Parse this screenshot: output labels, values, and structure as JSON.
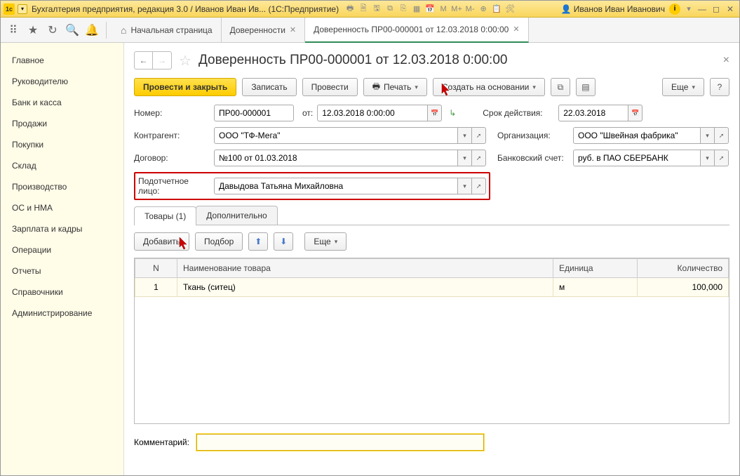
{
  "titlebar": {
    "app_title": "Бухгалтерия предприятия, редакция 3.0 / Иванов Иван Ив...  (1С:Предприятие)",
    "user": "Иванов Иван Иванович"
  },
  "tabs": {
    "home": "Начальная страница",
    "tab1": "Доверенности",
    "tab2": "Доверенность ПР00-000001 от 12.03.2018 0:00:00"
  },
  "sidebar": {
    "items": [
      "Главное",
      "Руководителю",
      "Банк и касса",
      "Продажи",
      "Покупки",
      "Склад",
      "Производство",
      "ОС и НМА",
      "Зарплата и кадры",
      "Операции",
      "Отчеты",
      "Справочники",
      "Администрирование"
    ]
  },
  "doc": {
    "title": "Доверенность ПР00-000001 от 12.03.2018 0:00:00"
  },
  "cmdbar": {
    "post_close": "Провести и закрыть",
    "save": "Записать",
    "post": "Провести",
    "print": "Печать",
    "create_based": "Создать на основании",
    "more": "Еще"
  },
  "form": {
    "number_label": "Номер:",
    "number_value": "ПР00-000001",
    "from_label": "от:",
    "date_value": "12.03.2018  0:00:00",
    "validity_label": "Срок действия:",
    "validity_value": "22.03.2018",
    "counterparty_label": "Контрагент:",
    "counterparty_value": "ООО \"ТФ-Мега\"",
    "org_label": "Организация:",
    "org_value": "ООО \"Швейная фабрика\"",
    "contract_label": "Договор:",
    "contract_value": "№100 от 01.03.2018",
    "bank_label": "Банковский счет:",
    "bank_value": "руб. в ПАО СБЕРБАНК",
    "person_label": "Подотчетное лицо:",
    "person_value": "Давыдова Татьяна Михайловна"
  },
  "subtabs": {
    "goods": "Товары (1)",
    "extra": "Дополнительно"
  },
  "table_toolbar": {
    "add": "Добавить",
    "select": "Подбор",
    "more": "Еще"
  },
  "table": {
    "headers": {
      "n": "N",
      "name": "Наименование товара",
      "unit": "Единица",
      "qty": "Количество"
    },
    "rows": [
      {
        "n": "1",
        "name": "Ткань (ситец)",
        "unit": "м",
        "qty": "100,000"
      }
    ]
  },
  "comment": {
    "label": "Комментарий:",
    "value": ""
  }
}
